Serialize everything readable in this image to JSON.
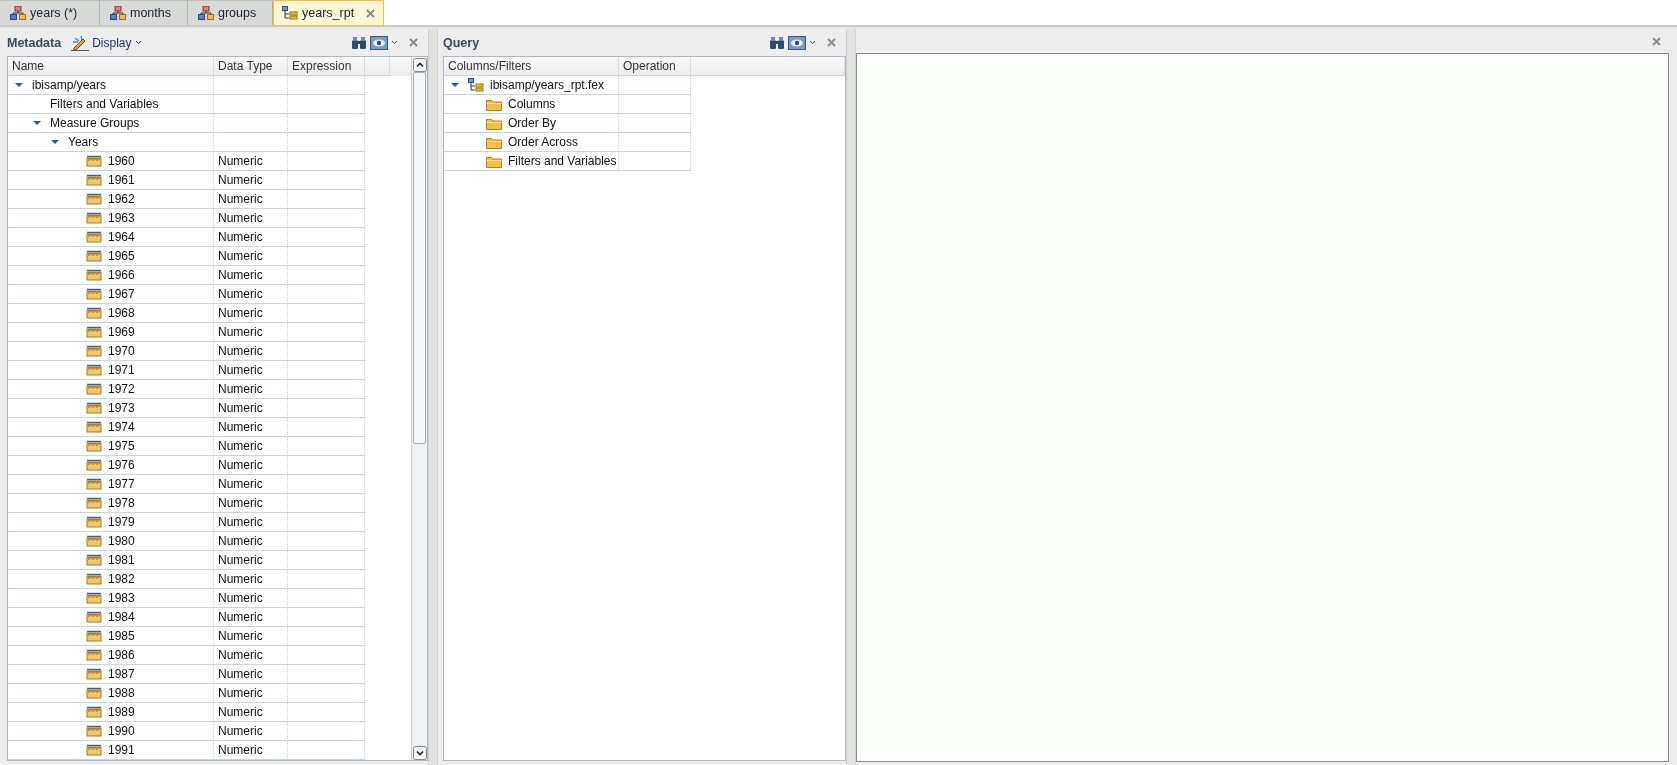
{
  "tabs": [
    {
      "label": "years (*)",
      "kind": "master",
      "selected": false
    },
    {
      "label": "months",
      "kind": "master",
      "selected": false
    },
    {
      "label": "groups",
      "kind": "master",
      "selected": false
    },
    {
      "label": "years_rpt",
      "kind": "report",
      "selected": true,
      "closable": true
    }
  ],
  "metadata": {
    "title": "Metadata",
    "display_button": "Display",
    "columns": [
      "Name",
      "Data Type",
      "Expression"
    ],
    "tree": [
      {
        "name": "ibisamp/years",
        "expanded": true,
        "children": [
          {
            "name": "Filters and Variables"
          },
          {
            "name": "Measure Groups",
            "expanded": true,
            "children": [
              {
                "name": "Years",
                "expanded": true,
                "children": [
                  {
                    "name": "1960",
                    "kind": "measure",
                    "data_type": "Numeric"
                  },
                  {
                    "name": "1961",
                    "kind": "measure",
                    "data_type": "Numeric"
                  },
                  {
                    "name": "1962",
                    "kind": "measure",
                    "data_type": "Numeric"
                  },
                  {
                    "name": "1963",
                    "kind": "measure",
                    "data_type": "Numeric"
                  },
                  {
                    "name": "1964",
                    "kind": "measure",
                    "data_type": "Numeric"
                  },
                  {
                    "name": "1965",
                    "kind": "measure",
                    "data_type": "Numeric"
                  },
                  {
                    "name": "1966",
                    "kind": "measure",
                    "data_type": "Numeric"
                  },
                  {
                    "name": "1967",
                    "kind": "measure",
                    "data_type": "Numeric"
                  },
                  {
                    "name": "1968",
                    "kind": "measure",
                    "data_type": "Numeric"
                  },
                  {
                    "name": "1969",
                    "kind": "measure",
                    "data_type": "Numeric"
                  },
                  {
                    "name": "1970",
                    "kind": "measure",
                    "data_type": "Numeric"
                  },
                  {
                    "name": "1971",
                    "kind": "measure",
                    "data_type": "Numeric"
                  },
                  {
                    "name": "1972",
                    "kind": "measure",
                    "data_type": "Numeric"
                  },
                  {
                    "name": "1973",
                    "kind": "measure",
                    "data_type": "Numeric"
                  },
                  {
                    "name": "1974",
                    "kind": "measure",
                    "data_type": "Numeric"
                  },
                  {
                    "name": "1975",
                    "kind": "measure",
                    "data_type": "Numeric"
                  },
                  {
                    "name": "1976",
                    "kind": "measure",
                    "data_type": "Numeric"
                  },
                  {
                    "name": "1977",
                    "kind": "measure",
                    "data_type": "Numeric"
                  },
                  {
                    "name": "1978",
                    "kind": "measure",
                    "data_type": "Numeric"
                  },
                  {
                    "name": "1979",
                    "kind": "measure",
                    "data_type": "Numeric"
                  },
                  {
                    "name": "1980",
                    "kind": "measure",
                    "data_type": "Numeric"
                  },
                  {
                    "name": "1981",
                    "kind": "measure",
                    "data_type": "Numeric"
                  },
                  {
                    "name": "1982",
                    "kind": "measure",
                    "data_type": "Numeric"
                  },
                  {
                    "name": "1983",
                    "kind": "measure",
                    "data_type": "Numeric"
                  },
                  {
                    "name": "1984",
                    "kind": "measure",
                    "data_type": "Numeric"
                  },
                  {
                    "name": "1985",
                    "kind": "measure",
                    "data_type": "Numeric"
                  },
                  {
                    "name": "1986",
                    "kind": "measure",
                    "data_type": "Numeric"
                  },
                  {
                    "name": "1987",
                    "kind": "measure",
                    "data_type": "Numeric"
                  },
                  {
                    "name": "1988",
                    "kind": "measure",
                    "data_type": "Numeric"
                  },
                  {
                    "name": "1989",
                    "kind": "measure",
                    "data_type": "Numeric"
                  },
                  {
                    "name": "1990",
                    "kind": "measure",
                    "data_type": "Numeric"
                  },
                  {
                    "name": "1991",
                    "kind": "measure",
                    "data_type": "Numeric"
                  }
                ]
              }
            ]
          }
        ]
      }
    ]
  },
  "query": {
    "title": "Query",
    "columns": [
      "Columns/Filters",
      "Operation"
    ],
    "tree": [
      {
        "name": "ibisamp/years_rpt.fex",
        "kind": "report",
        "expanded": true,
        "children": [
          {
            "name": "Columns",
            "kind": "folder"
          },
          {
            "name": "Order By",
            "kind": "folder"
          },
          {
            "name": "Order Across",
            "kind": "folder"
          },
          {
            "name": "Filters and Variables",
            "kind": "folder"
          }
        ]
      }
    ]
  }
}
